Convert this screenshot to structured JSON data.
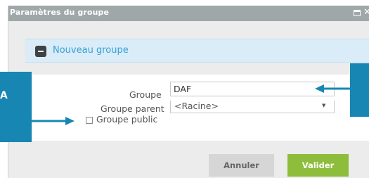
{
  "dialog": {
    "title": "Paramètres du groupe",
    "window_icons": [
      "maximize-icon",
      "close-icon"
    ]
  },
  "group": {
    "header_title": "Nouveau groupe",
    "collapse_icon": "minus-square-icon"
  },
  "form": {
    "groupe_label": "Groupe",
    "groupe_value": "DAF",
    "parent_label": "Groupe parent",
    "parent_value": "<Racine>",
    "public_label": "Groupe public",
    "public_checked": false
  },
  "buttons": {
    "cancel_label": "Annuler",
    "ok_label": "Valider"
  },
  "callouts": {
    "left_label": "A"
  },
  "colors": {
    "titlebar": "#9fa7a9",
    "header_bg": "#d9ecf7",
    "header_text": "#3aa0d5",
    "callout": "#1886b2",
    "ok_button": "#8dbd3a",
    "cancel_button": "#d6d6d6"
  }
}
